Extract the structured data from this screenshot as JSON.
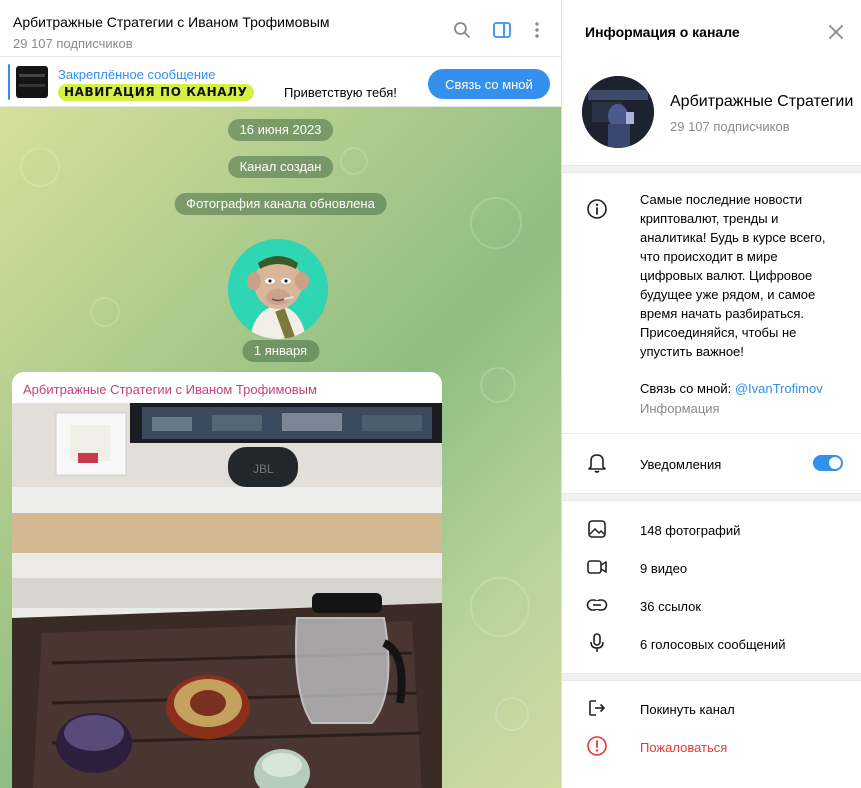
{
  "chat": {
    "title": "Арбитражные Стратегии с Иваном Трофимовым",
    "subscribers": "29 107 подписчиков",
    "pinned": {
      "title": "Закреплённое сообщение",
      "badge": "НАВИГАЦИЯ ПО КАНАЛУ",
      "preview": "Приветствую тебя!",
      "button": "Связь со мной"
    },
    "service": {
      "date1": "16 июня 2023",
      "created": "Канал создан",
      "photo_updated": "Фотография канала обновлена",
      "date2": "1 января"
    },
    "message": {
      "author": "Арбитражные Стратегии с Иваном Трофимовым"
    },
    "icons": [
      "search-icon",
      "sidebar-toggle-icon",
      "more-vertical-icon"
    ]
  },
  "info": {
    "header": "Информация о канале",
    "name": "Арбитражные Стратегии с Иваном Трофимовым",
    "subscribers": "29 107 подписчиков",
    "description": "Самые последние новости криптовалют, тренды и аналитика! Будь в курсе всего, что происходит в мире цифровых валют. Цифровое будущее уже рядом, и самое время начать разбираться. Присоединяйся, чтобы не упустить важное!",
    "contact_prefix": "Связь со мной: ",
    "contact_link": "@IvanTrofimov",
    "description_label": "Информация",
    "notifications": "Уведомления",
    "notifications_on": true,
    "media": {
      "photos": "148 фотографий",
      "videos": "9 видео",
      "links": "36 ссылок",
      "voice": "6 голосовых сообщений"
    },
    "leave": "Покинуть канал",
    "report": "Пожаловаться"
  },
  "colors": {
    "accent": "#3390ec",
    "author": "#c53f7a",
    "danger": "#e53935",
    "badge": "#d7f046"
  }
}
